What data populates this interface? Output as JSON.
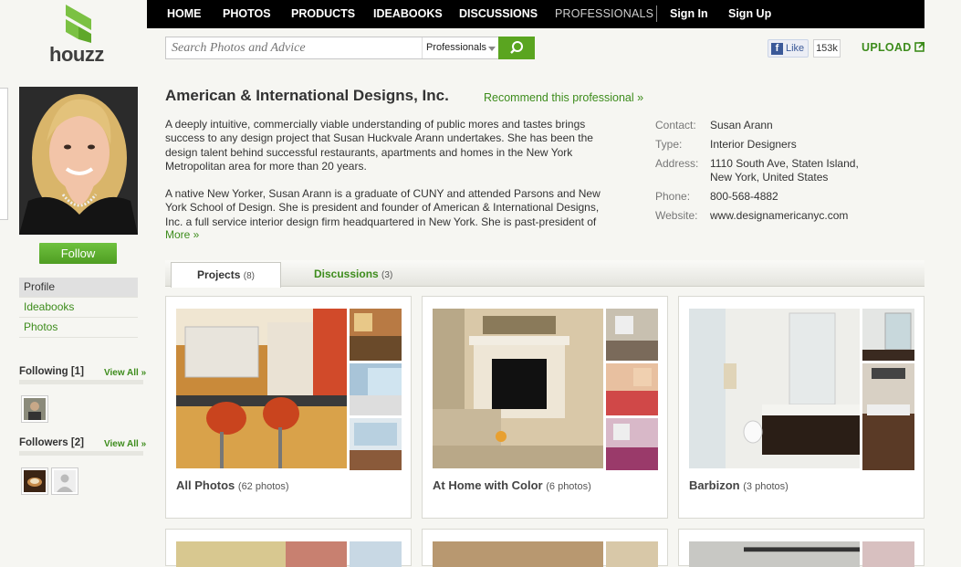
{
  "nav": {
    "items": [
      "HOME",
      "PHOTOS",
      "PRODUCTS",
      "IDEABOOKS",
      "DISCUSSIONS",
      "PROFESSIONALS"
    ],
    "sign_in": "Sign In",
    "sign_up": "Sign Up"
  },
  "logo": {
    "text": "houzz"
  },
  "search": {
    "placeholder": "Search Photos and Advice",
    "scope": "Professionals"
  },
  "social": {
    "like_label": "Like",
    "like_count": "153k"
  },
  "upload": {
    "label": "UPLOAD"
  },
  "profile": {
    "name": "American & International Designs, Inc.",
    "recommend": "Recommend this professional »",
    "about_1": "A deeply intuitive, commercially viable understanding of public mores and tastes brings success to any design project that Susan Huckvale Arann undertakes. She has been the design talent behind successful restaurants, apartments and homes in the New York Metropolitan area for more than 20 years.",
    "about_2": "A native New Yorker, Susan Arann is a graduate of CUNY and attended Parsons and New York School of Design. She is president and founder of American & International Designs, Inc. a full service interior design firm headquartered in New York. She is past-president of",
    "more": "More »",
    "info": {
      "contact_label": "Contact:",
      "contact": "Susan Arann",
      "type_label": "Type:",
      "type": "Interior Designers",
      "address_label": "Address:",
      "address_1": "1110 South Ave, Staten Island,",
      "address_2": "New York, United States",
      "phone_label": "Phone:",
      "phone": "800-568-4882",
      "website_label": "Website:",
      "website": "www.designamericanyc.com"
    }
  },
  "sidebar": {
    "follow": "Follow",
    "items": [
      "Profile",
      "Ideabooks",
      "Photos"
    ],
    "following_label": "Following [1]",
    "followers_label": "Followers [2]",
    "view_all": "View All »"
  },
  "tabs": {
    "projects": "Projects",
    "projects_count": "(8)",
    "discussions": "Discussions",
    "discussions_count": "(3)"
  },
  "projects": [
    {
      "title": "All Photos",
      "count": "(62 photos)"
    },
    {
      "title": "At Home with Color",
      "count": "(6 photos)"
    },
    {
      "title": "Barbizon",
      "count": "(3 photos)"
    }
  ],
  "colors": {
    "brand_green": "#3d8c1c",
    "button_green": "#5aa520",
    "nav_bg": "#000000"
  }
}
